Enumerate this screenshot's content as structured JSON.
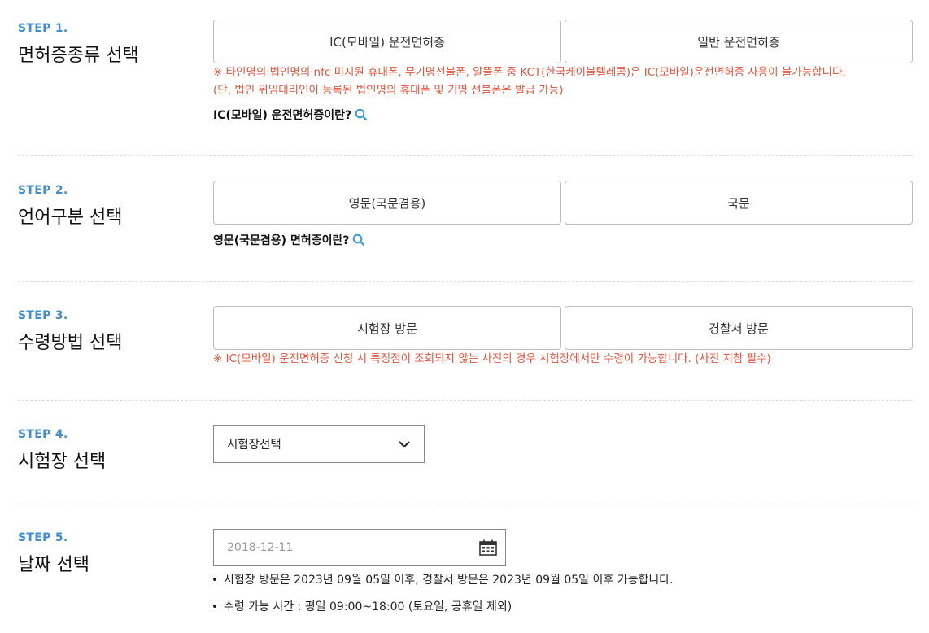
{
  "step1": {
    "num": "STEP 1.",
    "title": "면허증종류 선택",
    "options": [
      "IC(모바일) 운전면허증",
      "일반 운전면허증"
    ],
    "notice1": "※ 타인명의·법인명의·nfc 미지원 휴대폰, 무기명선불폰, 알뜰폰 중 KCT(한국케이블텔레콤)은 IC(모바일)운전면허증 사용이 불가능합니다.",
    "notice2": "(단, 법인 위임대리인이 등록된 법인명의 휴대폰 및 기명 선불폰은 발급 가능)",
    "info_link": "IC(모바일) 운전면허증이란?"
  },
  "step2": {
    "num": "STEP 2.",
    "title": "언어구분 선택",
    "options": [
      "영문(국문겸용)",
      "국문"
    ],
    "info_link": "영문(국문겸용) 면허증이란?"
  },
  "step3": {
    "num": "STEP 3.",
    "title": "수령방법 선택",
    "options": [
      "시험장 방문",
      "경찰서 방문"
    ],
    "notice1": "※ IC(모바일) 운전면허증 신청 시 특징점이 조회되지 않는 사진의 경우 시험장에서만 수령이 가능합니다. (사진 지참 필수)"
  },
  "step4": {
    "num": "STEP 4.",
    "title": "시험장 선택",
    "select_value": "시험장선택"
  },
  "step5": {
    "num": "STEP 5.",
    "title": "날짜 선택",
    "date_placeholder": "2018-12-11",
    "bullets": [
      "시험장 방문은 2023년 09월 05일 이후, 경찰서 방문은 2023년 09월 05일 이후 가능합니다.",
      "수령 가능 시간 : 평일 09:00~18:00 (토요일, 공휴일 제외)"
    ]
  },
  "colors": {
    "step_num": "#3f8fd2",
    "notice": "#e5533b",
    "search_icon": "#3a9bd6"
  },
  "icons": {
    "info_search": "search-icon",
    "select_arrow": "chevron-down-icon",
    "date_picker": "calendar-icon"
  }
}
